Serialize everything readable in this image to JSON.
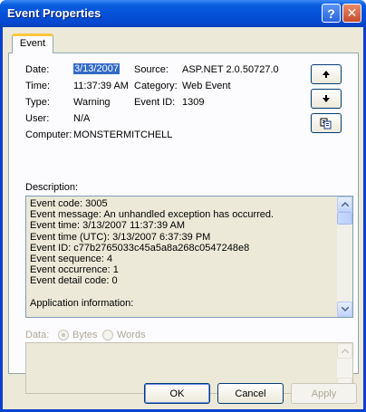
{
  "window": {
    "title": "Event Properties",
    "help_label": "?",
    "close_label": "✕"
  },
  "tab": {
    "label": "Event"
  },
  "fields": {
    "date_label": "Date:",
    "date_value": "3/13/2007",
    "time_label": "Time:",
    "time_value": "11:37:39 AM",
    "type_label": "Type:",
    "type_value": "Warning",
    "user_label": "User:",
    "user_value": "N/A",
    "computer_label": "Computer:",
    "computer_value": "MONSTERMITCHELL",
    "source_label": "Source:",
    "source_value": "ASP.NET 2.0.50727.0",
    "category_label": "Category:",
    "category_value": "Web Event",
    "eventid_label": "Event ID:",
    "eventid_value": "1309"
  },
  "nav_buttons": {
    "up_icon": "arrow-up-icon",
    "down_icon": "arrow-down-icon",
    "copy_icon": "copy-icon"
  },
  "description": {
    "label": "Description:",
    "lines": [
      "Event code: 3005",
      "Event message: An unhandled exception has occurred.",
      "Event time: 3/13/2007 11:37:39 AM",
      "Event time (UTC): 3/13/2007 6:37:39 PM",
      "Event ID: c77b2765033c45a5a8a268c0547248e8",
      "Event sequence: 4",
      "Event occurrence: 1",
      "Event detail code: 0",
      "",
      "Application information:"
    ]
  },
  "data": {
    "label": "Data:",
    "bytes_label": "Bytes",
    "words_label": "Words",
    "selected": "Bytes"
  },
  "buttons": {
    "ok": "OK",
    "cancel": "Cancel",
    "apply": "Apply"
  }
}
